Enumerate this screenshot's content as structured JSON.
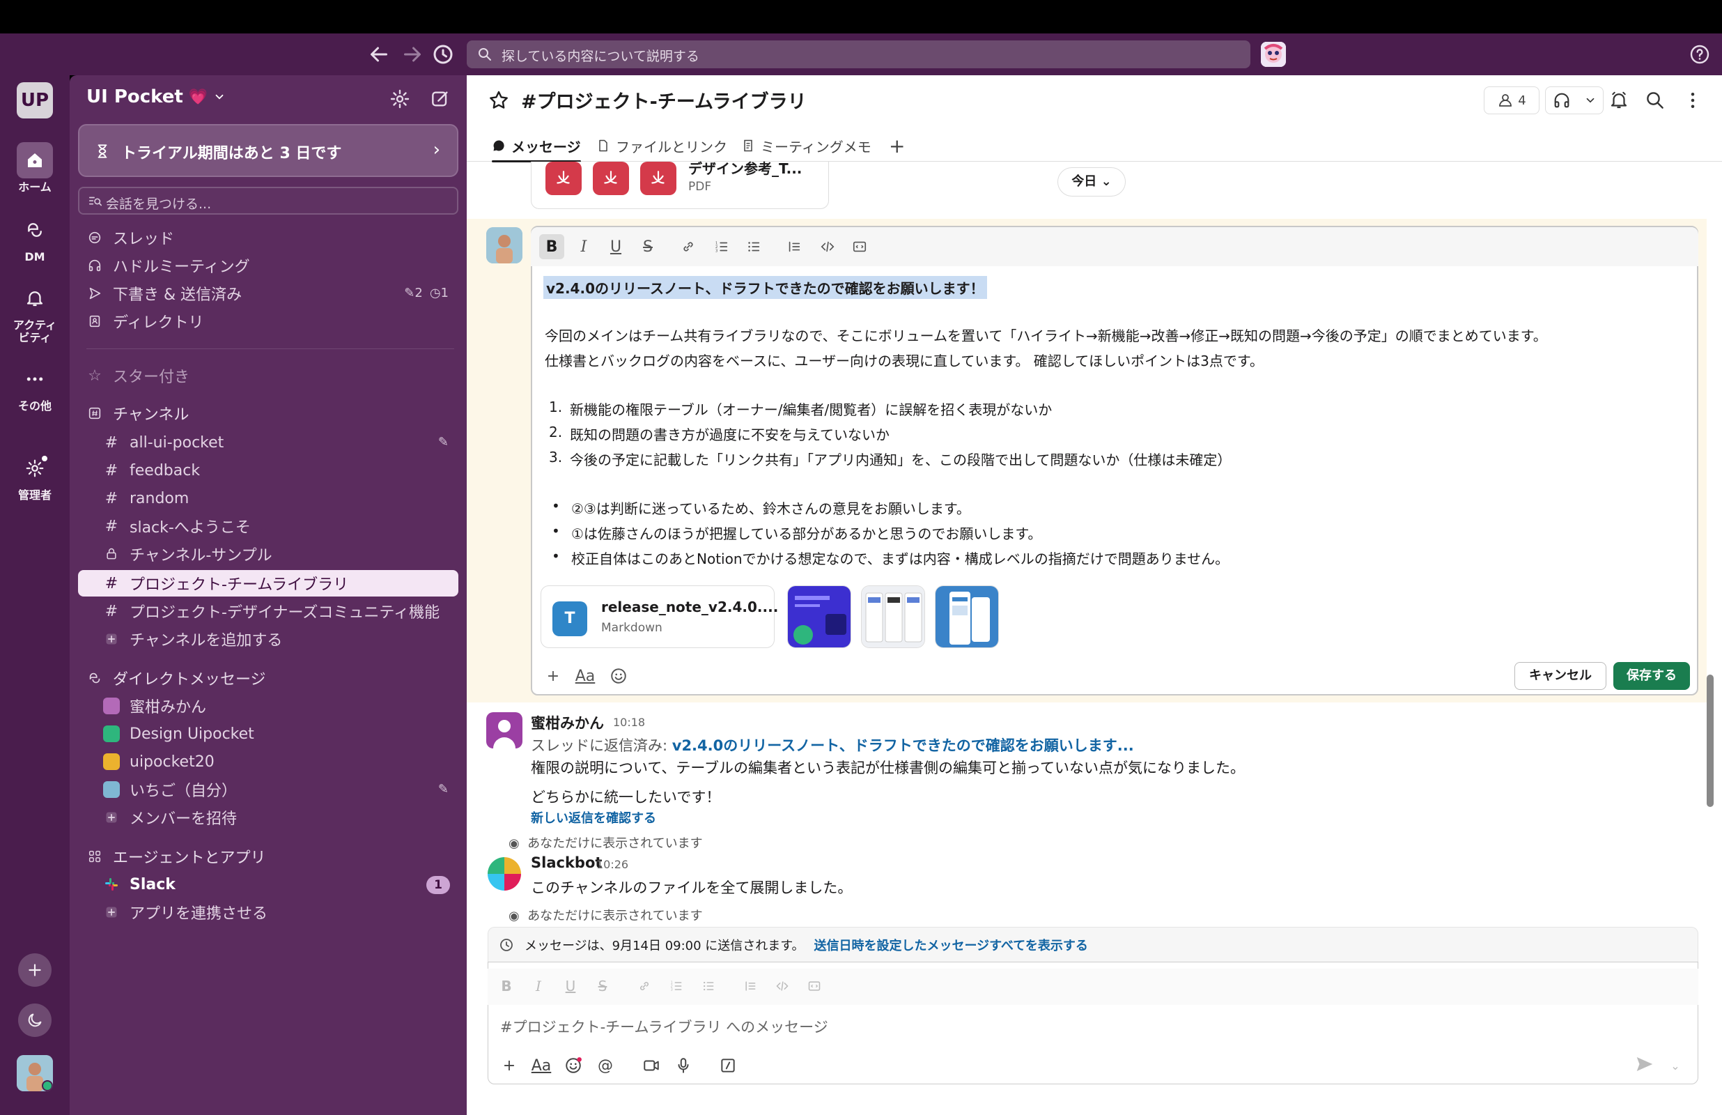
{
  "topbar": {
    "search_placeholder": "探している内容について説明する"
  },
  "rail": {
    "workspace_initials": "UP",
    "items": [
      {
        "label": "ホーム"
      },
      {
        "label": "DM"
      },
      {
        "label": "アクティビティ"
      },
      {
        "label": "その他"
      },
      {
        "label": "管理者"
      }
    ]
  },
  "sidebar": {
    "workspace_name": "UI Pocket",
    "workspace_emoji": "💗",
    "trial_banner": "トライアル期間はあと 3 日です",
    "find_placeholder": "会話を見つける...",
    "nav": [
      {
        "label": "スレッド"
      },
      {
        "label": "ハドルミーティング"
      },
      {
        "label": "下書き & 送信済み",
        "drafts": "2",
        "scheduled": "1"
      },
      {
        "label": "ディレクトリ"
      }
    ],
    "starred_label": "スター付き",
    "channels_label": "チャンネル",
    "channels": [
      {
        "name": "all-ui-pocket"
      },
      {
        "name": "feedback"
      },
      {
        "name": "random"
      },
      {
        "name": "slack-へようこそ"
      },
      {
        "name": "チャンネル-サンプル"
      },
      {
        "name": "プロジェクト-チームライブラリ"
      },
      {
        "name": "プロジェクト-デザイナーズコミュニティ機能"
      }
    ],
    "add_channel": "チャンネルを追加する",
    "dm_label": "ダイレクトメッセージ",
    "dms": [
      {
        "name": "蜜柑みかん",
        "color": "#b36ab8"
      },
      {
        "name": "Design Uipocket",
        "color": "#2eb67d"
      },
      {
        "name": "uipocket20",
        "color": "#ecb22e"
      },
      {
        "name": "いちご（自分）",
        "color": "#7fb7d3"
      }
    ],
    "invite": "メンバーを招待",
    "apps_label": "エージェントとアプリ",
    "slack_app": "Slack",
    "slack_badge": "1",
    "connect_apps": "アプリを連携させる"
  },
  "channel": {
    "title": "#プロジェクト-チームライブラリ",
    "member_count": "4",
    "tabs": [
      {
        "label": "メッセージ"
      },
      {
        "label": "ファイルとリンク"
      },
      {
        "label": "ミーティングメモ"
      }
    ]
  },
  "messages": {
    "pdf_name": "デザイン参考_T...",
    "pdf_type": "PDF",
    "date_divider": "今日",
    "editor": {
      "headline": "v2.4.0のリリースノート、ドラフトできたので確認をお願いします！",
      "para1": "今回のメインはチーム共有ライブラリなので、そこにボリュームを置いて「ハイライト→新機能→改善→修正→既知の問題→今後の予定」の順でまとめています。",
      "para2": "仕様書とバックログの内容をベースに、ユーザー向けの表現に直しています。 確認してほしいポイントは3点です。",
      "numbered": [
        "新機能の権限テーブル（オーナー/編集者/閲覧者）に誤解を招く表現がないか",
        "既知の問題の書き方が過度に不安を与えていないか",
        "今後の予定に記載した「リンク共有」「アプリ内通知」を、この段階で出して問題ないか（仕様は未確定）"
      ],
      "bullets": [
        "②③は判断に迷っているため、鈴木さんの意見をお願いします。",
        "①は佐藤さんのほうが把握している部分があるかと思うのでお願いします。",
        "校正自体はこのあとNotionでかける想定なので、まずは内容・構成レベルの指摘だけで問題ありません。"
      ],
      "file_name": "release_note_v2.4.0....",
      "file_type": "Markdown",
      "file_icon": "T",
      "cancel": "キャンセル",
      "save": "保存する"
    },
    "reply": {
      "author": "蜜柑みかん",
      "time": "10:18",
      "thread_prefix": "スレッドに返信済み: ",
      "thread_link": "v2.4.0のリリースノート、ドラフトできたので確認をお願いします...",
      "line1": "権限の説明について、テーブルの編集者という表記が仕様書側の編集可と揃っていない点が気になりました。",
      "line2": "どちらかに統一したいです！",
      "new_replies": "新しい返信を確認する"
    },
    "visible_only_1": "あなただけに表示されています",
    "slackbot": {
      "author": "Slackbot",
      "time": "10:26",
      "text": "このチャンネルのファイルを全て展開しました。"
    },
    "visible_only_2": "あなただけに表示されています"
  },
  "composer": {
    "schedule_text": "メッセージは、9月14日 09:00 に送信されます。",
    "schedule_link": "送信日時を設定したメッセージすべてを表示する",
    "placeholder": "#プロジェクト-チームライブラリ へのメッセージ"
  }
}
